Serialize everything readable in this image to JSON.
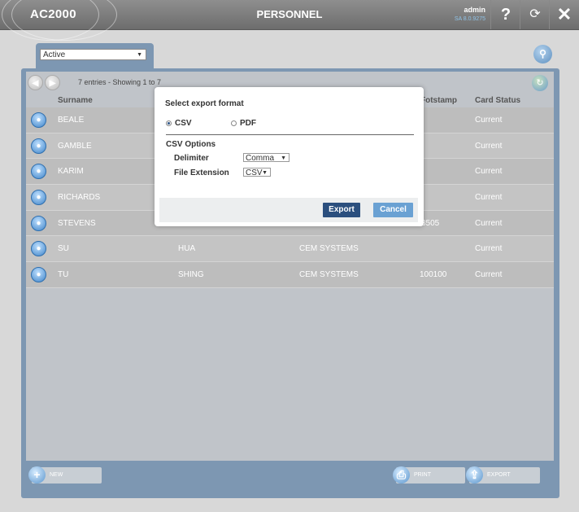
{
  "header": {
    "logo": "AC2000",
    "title": "PERSONNEL",
    "user": "admin",
    "version": "SA 8.0.9275",
    "help_icon": "?",
    "refresh_icon": "refresh-icon",
    "close_icon": "✕"
  },
  "filter": {
    "selected": "Active"
  },
  "table": {
    "entries_text": "7 entries - Showing 1 to 7",
    "columns": [
      "Surname",
      "Fotstamp",
      "Card Status"
    ],
    "rows": [
      {
        "surname": "BEALE",
        "forename": "",
        "company": "",
        "num": "",
        "status": "Current"
      },
      {
        "surname": "GAMBLE",
        "forename": "",
        "company": "",
        "num": "",
        "status": "Current"
      },
      {
        "surname": "KARIM",
        "forename": "",
        "company": "",
        "num": "",
        "status": "Current"
      },
      {
        "surname": "RICHARDS",
        "forename": "",
        "company": "",
        "num": "",
        "status": "Current"
      },
      {
        "surname": "STEVENS",
        "forename": "",
        "company": "",
        "num": "3505",
        "status": "Current"
      },
      {
        "surname": "SU",
        "forename": "HUA",
        "company": "CEM SYSTEMS",
        "num": "",
        "status": "Current"
      },
      {
        "surname": "TU",
        "forename": "SHING",
        "company": "CEM SYSTEMS",
        "num": "100100",
        "status": "Current"
      }
    ]
  },
  "toolbar": {
    "new": "NEW",
    "print": "PRINT",
    "export": "EXPORT"
  },
  "modal": {
    "title": "Select export format",
    "opt_csv": "CSV",
    "opt_pdf": "PDF",
    "selected": "CSV",
    "csv_options": "CSV Options",
    "delimiter_label": "Delimiter",
    "delimiter_value": "Comma",
    "ext_label": "File Extension",
    "ext_value": "CSV",
    "export_btn": "Export",
    "cancel_btn": "Cancel"
  }
}
